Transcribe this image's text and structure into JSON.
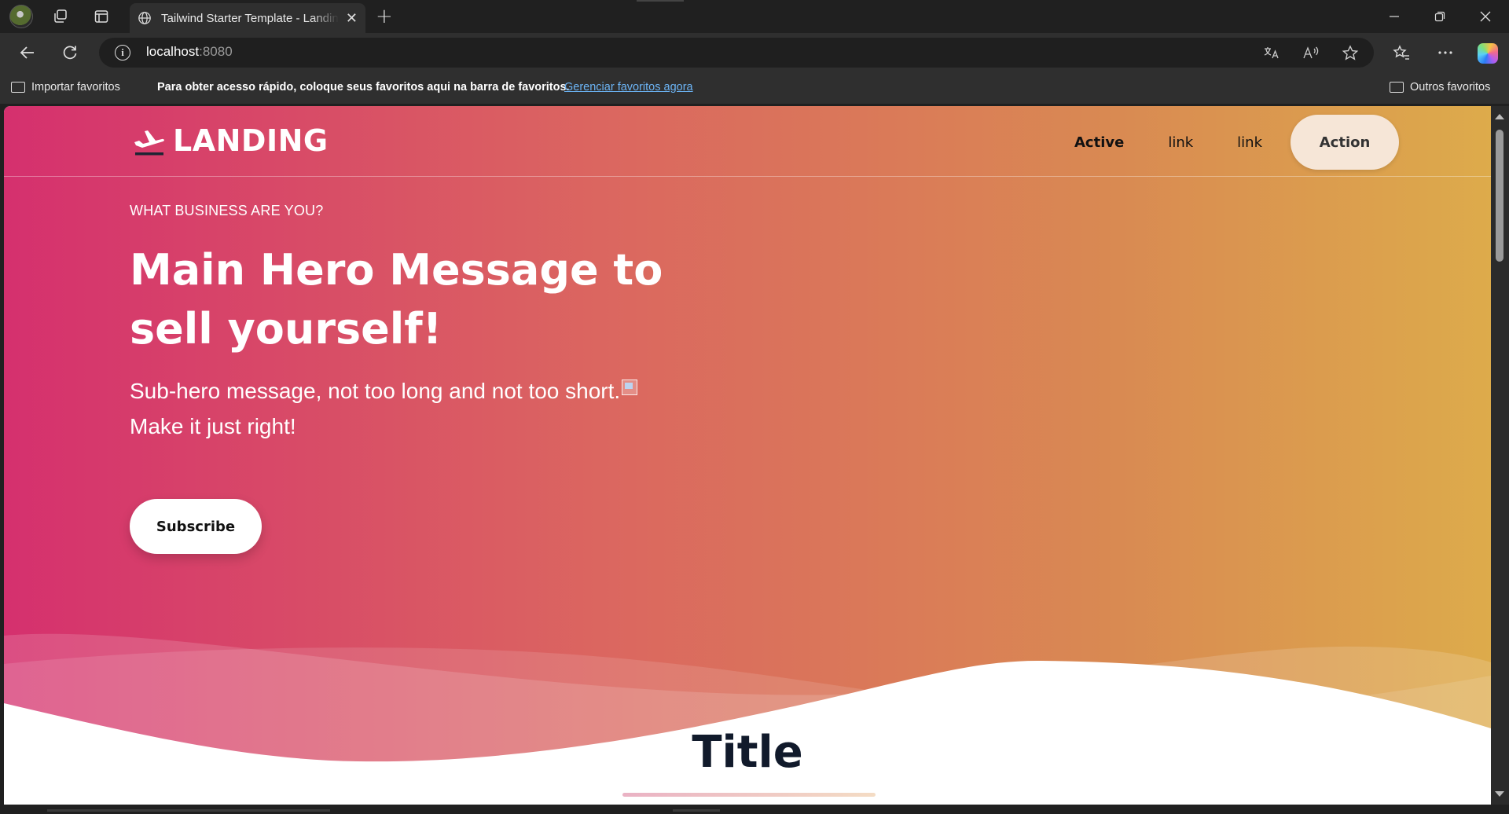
{
  "browser": {
    "tab_title": "Tailwind Starter Template - Landing Page",
    "url_host": "localhost",
    "url_port": ":8080",
    "favorites_bar": {
      "import_label": "Importar favoritos",
      "message": "Para obter acesso rápido, coloque seus favoritos aqui na barra de favoritos.",
      "manage_link": "Gerenciar favoritos agora",
      "other_label": "Outros favoritos"
    },
    "new_tab_symbol": "+",
    "close_symbol": "✕"
  },
  "page": {
    "brand": "LANDING",
    "nav": {
      "active": "Active",
      "link1": "link",
      "link2": "link",
      "action": "Action"
    },
    "hero": {
      "eyebrow": "WHAT BUSINESS ARE YOU?",
      "headline": "Main Hero Message to sell yourself!",
      "subhero_line1": "Sub-hero message, not too long and not too short.",
      "subhero_line2": "Make it just right!",
      "cta": "Subscribe"
    },
    "section_title": "Title"
  },
  "colors": {
    "gradient_start": "#d5306e",
    "gradient_end": "#ddab4b",
    "action_bg": "#f6e6d7",
    "title_color": "#111a2b"
  }
}
